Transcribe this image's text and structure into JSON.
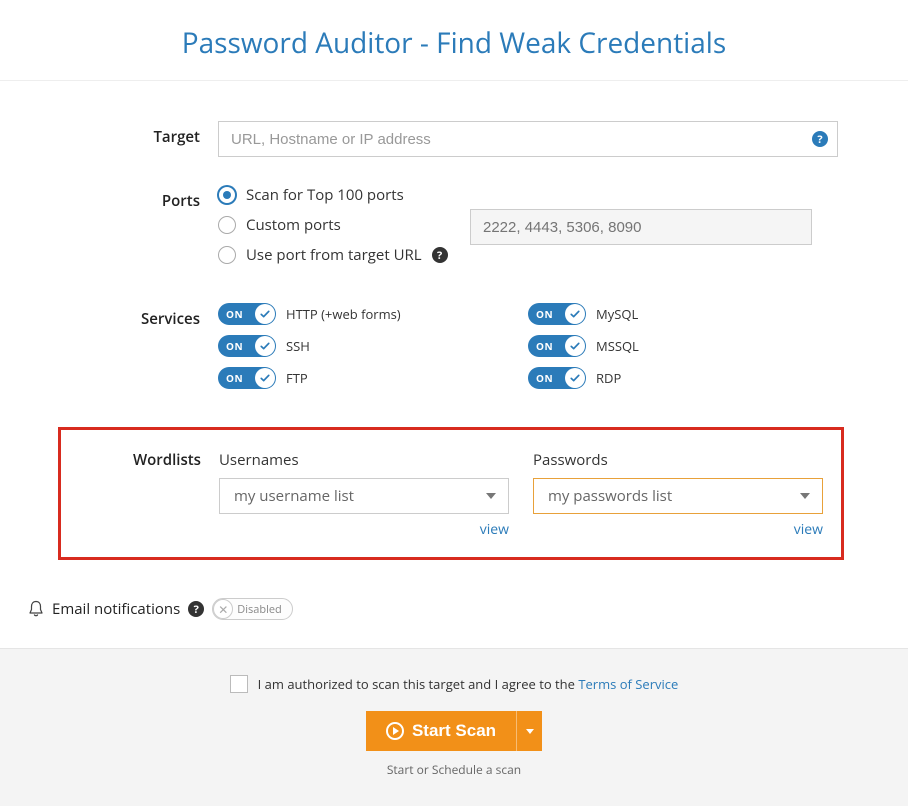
{
  "title": "Password Auditor - Find Weak Credentials",
  "target": {
    "label": "Target",
    "placeholder": "URL, Hostname or IP address"
  },
  "ports": {
    "label": "Ports",
    "opt1": "Scan for Top 100 ports",
    "opt2": "Custom ports",
    "opt3": "Use port from target URL",
    "custom_placeholder": "2222, 4443, 5306, 8090"
  },
  "services": {
    "label": "Services",
    "on": "ON",
    "left": [
      "HTTP (+web forms)",
      "SSH",
      "FTP"
    ],
    "right": [
      "MySQL",
      "MSSQL",
      "RDP"
    ]
  },
  "wordlists": {
    "label": "Wordlists",
    "usernames_label": "Usernames",
    "passwords_label": "Passwords",
    "usernames_value": "my username list",
    "passwords_value": "my passwords list",
    "view": "view"
  },
  "notifications": {
    "label": "Email notifications",
    "state": "Disabled"
  },
  "footer": {
    "auth_text": "I am authorized to scan this target and I agree to the ",
    "tos": "Terms of Service",
    "start": "Start Scan",
    "note": "Start or Schedule a scan"
  }
}
